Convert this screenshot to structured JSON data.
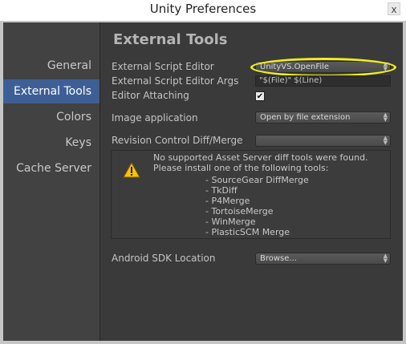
{
  "window": {
    "title": "Unity Preferences",
    "close_glyph": "x"
  },
  "sidebar": {
    "items": [
      {
        "label": "General",
        "selected": false
      },
      {
        "label": "External Tools",
        "selected": true
      },
      {
        "label": "Colors",
        "selected": false
      },
      {
        "label": "Keys",
        "selected": false
      },
      {
        "label": "Cache Server",
        "selected": false
      }
    ]
  },
  "main": {
    "heading": "External Tools",
    "external_script_editor": {
      "label": "External Script Editor",
      "value": "UnityVS.OpenFile"
    },
    "external_script_editor_args": {
      "label": "External Script Editor Args",
      "value": "\"$(File)\" $(Line)"
    },
    "editor_attaching": {
      "label": "Editor Attaching",
      "checked": true,
      "check_glyph": "✔"
    },
    "image_application": {
      "label": "Image application",
      "value": "Open by file extension"
    },
    "revision_control": {
      "label": "Revision Control Diff/Merge",
      "value": ""
    },
    "diff_notice": {
      "line1": "No supported Asset Server diff tools were found.",
      "line2": "Please install one of the following tools:",
      "tools": [
        "- SourceGear DiffMerge",
        "- TkDiff",
        "- P4Merge",
        "- TortoiseMerge",
        "- WinMerge",
        "- PlasticSCM Merge"
      ],
      "icon": "warning-icon"
    },
    "android_sdk": {
      "label": "Android SDK Location",
      "value": "Browse..."
    }
  },
  "colors": {
    "selected_bg": "#3e5f96",
    "highlight": "#f2ef1a",
    "sidebar_bg": "#424242",
    "main_bg": "#3a3a3a"
  }
}
